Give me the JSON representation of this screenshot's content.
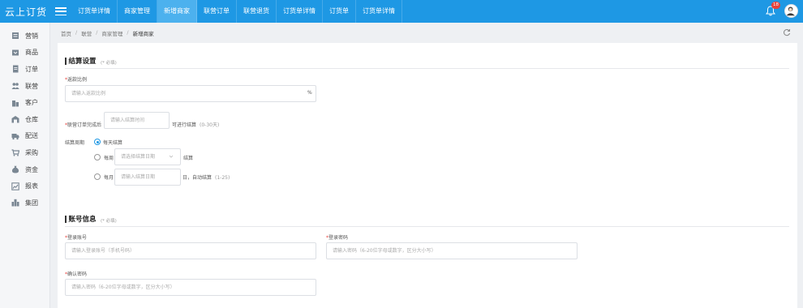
{
  "app": {
    "logo": "云上订货"
  },
  "topnav": {
    "tabs": [
      "订货单详情",
      "商家管理",
      "新增商家",
      "联营订单",
      "联营退货",
      "订货单详情",
      "订货单",
      "订货单详情"
    ],
    "active_index": 2,
    "notification_count": "18"
  },
  "sidebar": {
    "items": [
      {
        "label": "营销",
        "icon": "marketing-icon"
      },
      {
        "label": "商品",
        "icon": "goods-icon"
      },
      {
        "label": "订单",
        "icon": "order-icon"
      },
      {
        "label": "联营",
        "icon": "partner-icon"
      },
      {
        "label": "客户",
        "icon": "customer-icon"
      },
      {
        "label": "仓库",
        "icon": "warehouse-icon"
      },
      {
        "label": "配送",
        "icon": "delivery-icon"
      },
      {
        "label": "采购",
        "icon": "purchase-icon"
      },
      {
        "label": "资金",
        "icon": "funds-icon"
      },
      {
        "label": "报表",
        "icon": "report-icon"
      },
      {
        "label": "集团",
        "icon": "group-icon"
      }
    ]
  },
  "breadcrumb": {
    "items": [
      "首页",
      "联营",
      "商家管理",
      "新增商家"
    ],
    "separator": "/"
  },
  "settlement": {
    "title": "结算设置",
    "note": "(* 必填)",
    "rebate_label": "返款比例",
    "rebate_placeholder": "请输入返款比例",
    "rebate_unit": "%",
    "order_label": "联营订单完成后",
    "order_placeholder": "请输入结算时间",
    "order_suffix": "可进行结算",
    "order_hint": "(0-30天)",
    "cycle_label": "结算周期",
    "daily_label": "每天结算",
    "weekly_label": "每周",
    "weekly_placeholder": "请选择结算日期",
    "weekly_suffix": "结算",
    "monthly_label": "每月",
    "monthly_placeholder": "请输入结算日期",
    "monthly_suffix": "日，自动结算",
    "monthly_hint": "(1-25)"
  },
  "account": {
    "title": "账号信息",
    "note": "(* 必填)",
    "login_label": "登录账号",
    "login_placeholder": "请输入登录账号（手机号码）",
    "password_label": "登录密码",
    "password_placeholder": "请输入密码（6-20位字母或数字，区分大小写）",
    "confirm_label": "确认密码",
    "confirm_placeholder": "请输入密码（6-20位字母或数字，区分大小写）"
  },
  "colors": {
    "primary": "#1e98e4",
    "active_tab": "#4cb1ee",
    "required": "#e8413a",
    "badge": "#e8413a"
  }
}
